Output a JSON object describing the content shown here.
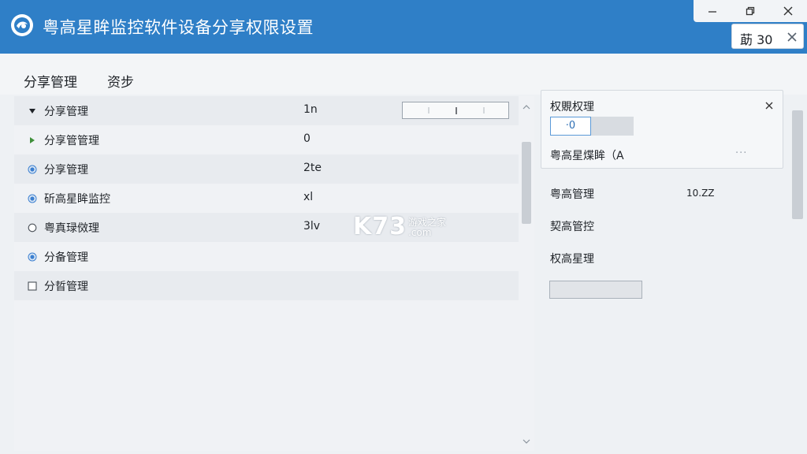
{
  "window": {
    "title": "粤高星眸监控软件设备分享权限设置",
    "tab_label": "莇 30"
  },
  "menu": {
    "items": [
      "分享管理",
      "资步"
    ]
  },
  "list": {
    "rows": [
      {
        "marker": "triangle-down-icon",
        "label": "分享管理",
        "value": "1n"
      },
      {
        "marker": "triangle-right-icon",
        "label": "分享管管理",
        "value": "0"
      },
      {
        "marker": "radio-filled-icon",
        "label": "分享管理",
        "value": "2te"
      },
      {
        "marker": "radio-filled-icon",
        "label": "斫高星眸监控",
        "value": "xl"
      },
      {
        "marker": "radio-empty-icon",
        "label": "粤真琭傚理",
        "value": "3lv"
      },
      {
        "marker": "radio-filled-icon",
        "label": "分备管理",
        "value": ""
      },
      {
        "marker": "checkbox-icon",
        "label": "分晢管理",
        "value": ""
      }
    ]
  },
  "detail": {
    "title": "权覞权理",
    "toggle_value": "·0",
    "subtitle": "粤高星煠眸（A",
    "more": "···",
    "props": [
      {
        "label": "粤高管理",
        "value": "10.ZZ"
      },
      {
        "label": "契高管控",
        "value": ""
      },
      {
        "label": "权高星理",
        "value": ""
      }
    ]
  },
  "watermark": {
    "brand": "K73",
    "cn": "游戏之家",
    "domain": ".com"
  },
  "colors": {
    "titlebar": "#2f7fc7",
    "accent": "#2f6fb4",
    "marker_green": "#3f8f3a",
    "marker_blue": "#3b7fd0"
  }
}
